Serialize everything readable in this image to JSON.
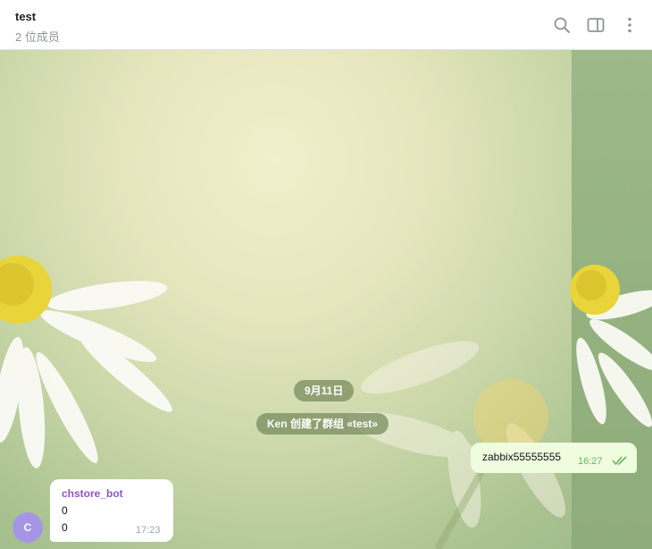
{
  "header": {
    "title": "test",
    "subtitle": "2 位成员",
    "icons": [
      "search-icon",
      "sidebar-toggle-icon",
      "more-vertical-icon"
    ]
  },
  "chat": {
    "date_divider": "9月11日",
    "service_message": "Ken 创建了群组 «test»",
    "messages": [
      {
        "direction": "outgoing",
        "text": "zabbix55555555",
        "time": "16:27",
        "status": "read"
      },
      {
        "direction": "incoming",
        "sender": "chstore_bot",
        "avatar_letter": "C",
        "lines": [
          "0",
          "0"
        ],
        "time": "17:23"
      }
    ]
  },
  "colors": {
    "outgoing_bubble": "#effdde",
    "incoming_bubble": "#ffffff",
    "sender_name": "#8e55c8",
    "avatar": "#a695e7",
    "read_check": "#6cb464"
  }
}
